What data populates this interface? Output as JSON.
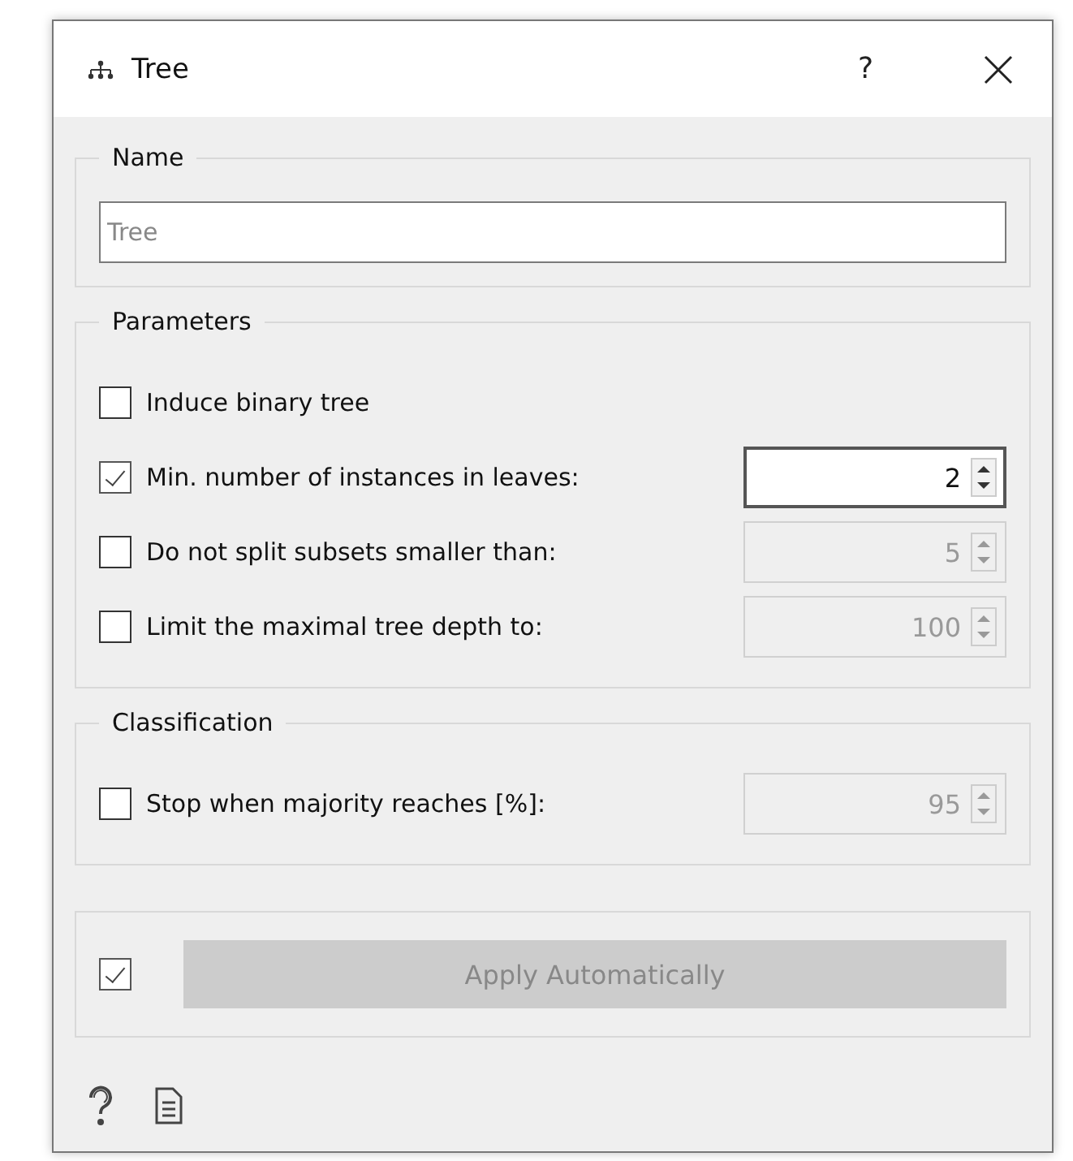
{
  "window": {
    "title": "Tree",
    "help": "?"
  },
  "groups": [
    {
      "kind": "name",
      "title": "Name",
      "field": {
        "placeholder": "Tree"
      }
    },
    {
      "kind": "options",
      "title": "Parameters",
      "rows": [
        {
          "label": "Induce binary tree",
          "checked": false
        },
        {
          "label": "Min. number of instances in leaves:",
          "checked": true,
          "spin": {
            "value": "2",
            "disabled": false
          }
        },
        {
          "label": "Do not split subsets smaller than:",
          "checked": false,
          "spin": {
            "value": "5",
            "disabled": true
          }
        },
        {
          "label": "Limit the maximal tree depth to:",
          "checked": false,
          "spin": {
            "value": "100",
            "disabled": true
          }
        }
      ]
    },
    {
      "kind": "options",
      "title": "Classification",
      "rows": [
        {
          "label": "Stop when majority reaches [%]:",
          "checked": false,
          "spin": {
            "value": "95",
            "disabled": true
          }
        }
      ]
    },
    {
      "kind": "apply",
      "checked": true,
      "button": {
        "label": "Apply Automatically",
        "disabled": true
      }
    }
  ]
}
